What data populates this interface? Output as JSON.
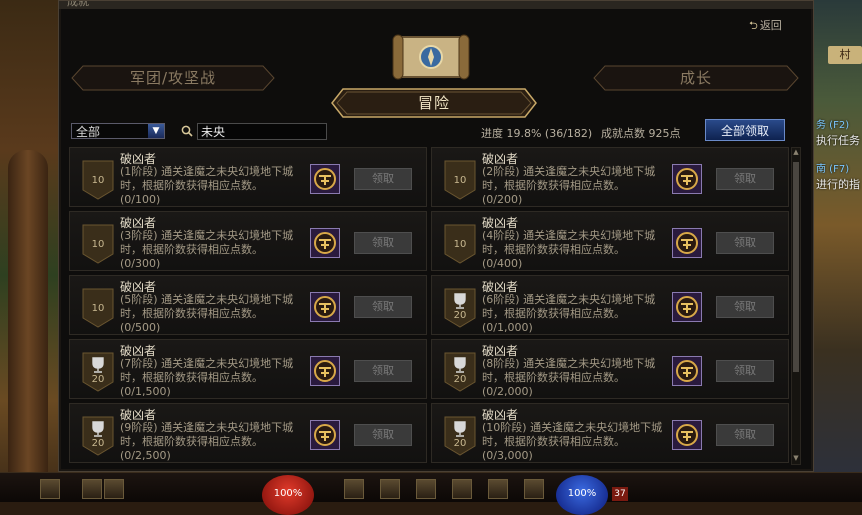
{
  "window": {
    "title": "成就",
    "back_label": "返回"
  },
  "tabs": {
    "left": "军团/攻坚战",
    "right": "成长",
    "active": "冒险"
  },
  "filter": {
    "category_selected": "全部",
    "search_value": "未央"
  },
  "stats": {
    "progress": "进度 19.8% (36/182)",
    "points": "成就点数 925点",
    "progress_fraction": 0.198
  },
  "claim_all_label": "全部领取",
  "achievements": [
    {
      "name": "破凶者",
      "desc": "(1阶段) 通关逢魔之未央幻境地下城时，根据阶数获得相应点数。",
      "count": "(0/100)",
      "medal": "10",
      "trophy": false,
      "claim": "领取"
    },
    {
      "name": "破凶者",
      "desc": "(2阶段) 通关逢魔之未央幻境地下城时，根据阶数获得相应点数。",
      "count": "(0/200)",
      "medal": "10",
      "trophy": false,
      "claim": "领取"
    },
    {
      "name": "破凶者",
      "desc": "(3阶段) 通关逢魔之未央幻境地下城时，根据阶数获得相应点数。",
      "count": "(0/300)",
      "medal": "10",
      "trophy": false,
      "claim": "领取"
    },
    {
      "name": "破凶者",
      "desc": "(4阶段) 通关逢魔之未央幻境地下城时，根据阶数获得相应点数。",
      "count": "(0/400)",
      "medal": "10",
      "trophy": false,
      "claim": "领取"
    },
    {
      "name": "破凶者",
      "desc": "(5阶段) 通关逢魔之未央幻境地下城时，根据阶数获得相应点数。",
      "count": "(0/500)",
      "medal": "10",
      "trophy": false,
      "claim": "领取"
    },
    {
      "name": "破凶者",
      "desc": "(6阶段) 通关逢魔之未央幻境地下城时，根据阶数获得相应点数。",
      "count": "(0/1,000)",
      "medal": "20",
      "trophy": true,
      "claim": "领取"
    },
    {
      "name": "破凶者",
      "desc": "(7阶段) 通关逢魔之未央幻境地下城时，根据阶数获得相应点数。",
      "count": "(0/1,500)",
      "medal": "20",
      "trophy": true,
      "claim": "领取"
    },
    {
      "name": "破凶者",
      "desc": "(8阶段) 通关逢魔之未央幻境地下城时，根据阶数获得相应点数。",
      "count": "(0/2,000)",
      "medal": "20",
      "trophy": true,
      "claim": "领取"
    },
    {
      "name": "破凶者",
      "desc": "(9阶段) 通关逢魔之未央幻境地下城时，根据阶数获得相应点数。",
      "count": "(0/2,500)",
      "medal": "20",
      "trophy": true,
      "claim": "领取"
    },
    {
      "name": "破凶者",
      "desc": "(10阶段) 通关逢魔之未央幻境地下城时，根据阶数获得相应点数。",
      "count": "(0/3,000)",
      "medal": "20",
      "trophy": true,
      "claim": "领取"
    }
  ],
  "background": {
    "right_hints": [
      {
        "text": "务 (F2)",
        "key": true
      },
      {
        "text": "执行任务",
        "key": false
      },
      {
        "text": "南 (F7)",
        "key": true
      },
      {
        "text": "进行的指",
        "key": false
      }
    ],
    "village_label": "村",
    "hp_text": "100%",
    "mp_text": "100%",
    "level_badge": "37"
  },
  "colors": {
    "accent_blue": "#2a4a8a",
    "claim_disabled": "#3a3a3a",
    "title_gold": "#f0e4c4"
  }
}
